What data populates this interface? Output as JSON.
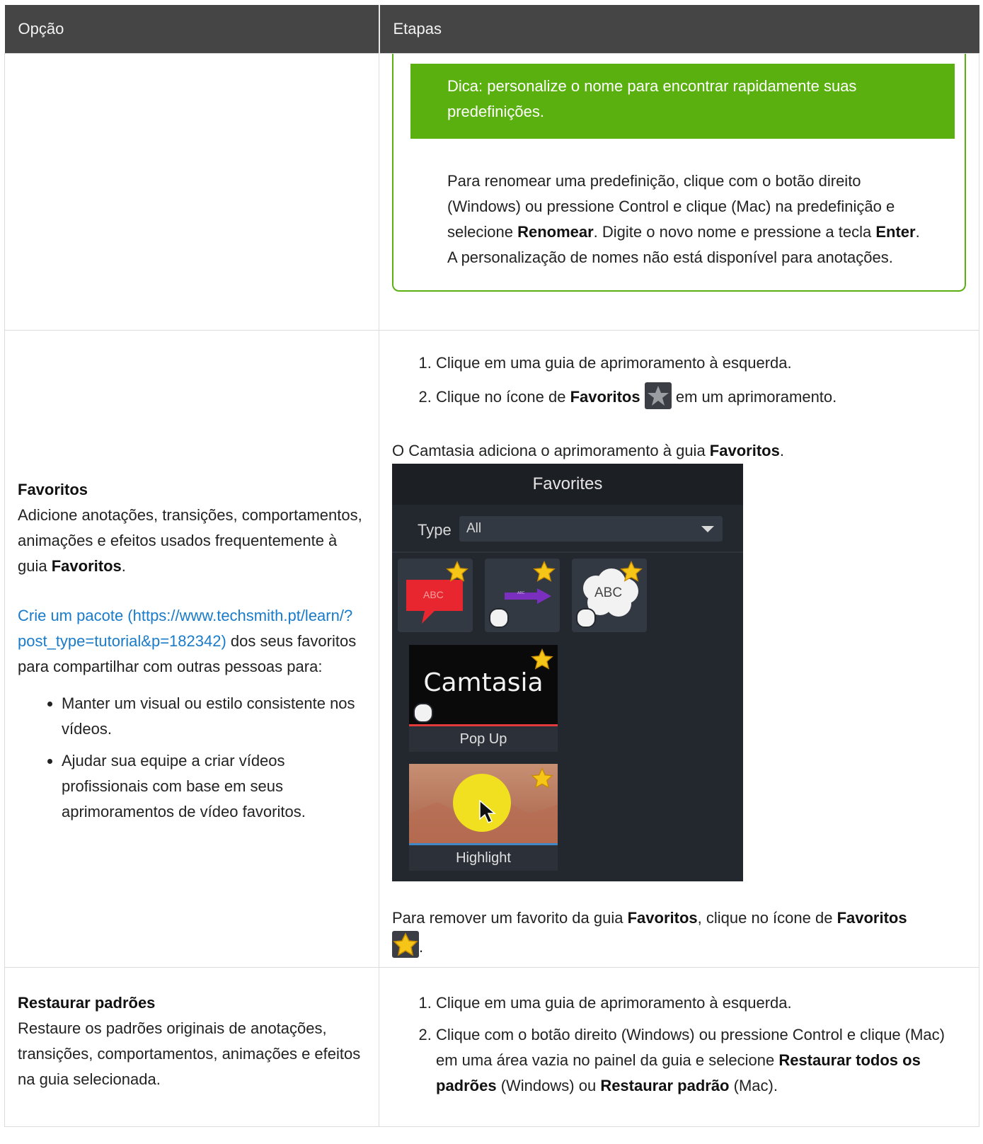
{
  "table": {
    "header": {
      "col1": "Opção",
      "col2": "Etapas"
    },
    "row1": {
      "tip": "Dica: personalize o nome para encontrar rapidamente suas predefinições.",
      "p1": "Para renomear uma predefinição, clique com o botão direito (Windows) ou pressione Control e clique (Mac) na predefinição e selecione ",
      "p1_b1": "Renomear",
      "p1_mid": ". Digite o novo nome e pressione a tecla ",
      "p1_b2": "Enter",
      "p1_end": ". A personalização de nomes não está disponível para anotações."
    },
    "row2": {
      "title": "Favoritos",
      "desc_a": "Adicione anotações, transições, comportamentos, animações e efeitos usados frequentemente à guia ",
      "desc_b": "Favoritos",
      "desc_c": ".",
      "link": "Crie um pacote (https://www.techsmith.pt/learn/?post_type=tutorial&p=182342)",
      "link_after": " dos seus favoritos para compartilhar com outras pessoas para:",
      "bullets": [
        "Manter um visual ou estilo consistente nos vídeos.",
        "Ajudar sua equipe a criar vídeos profissionais com base em seus aprimoramentos de vídeo favoritos."
      ],
      "step1": "Clique em uma guia de aprimoramento à esquerda.",
      "step2_a": "Clique no ícone de ",
      "step2_b": "Favoritos",
      "step2_c": " em um aprimoramento.",
      "result_a": "O Camtasia adiciona o aprimoramento à guia ",
      "result_b": "Favoritos",
      "result_c": ".",
      "panel": {
        "title": "Favorites",
        "type_label": "Type",
        "type_value": "All",
        "tile1_text": "ABC",
        "tile2_text": "ABC",
        "tile3_text": "ABC",
        "camtasia_text": "Camtasia",
        "popup_label": "Pop Up",
        "highlight_label": "Highlight"
      },
      "remove_a": "Para remover um favorito da guia ",
      "remove_b": "Favoritos",
      "remove_c": ", clique no ícone de ",
      "remove_d": "Favoritos",
      "remove_e": "."
    },
    "row3": {
      "title": "Restaurar padrões",
      "desc": "Restaure os padrões originais de anotações, transições, comportamentos, animações e efeitos na guia selecionada.",
      "step1": "Clique em uma guia de aprimoramento à esquerda.",
      "step2_a": "Clique com o botão direito (Windows) ou pressione Control e clique (Mac) em uma área vazia no painel da guia e selecione ",
      "step2_b": "Restaurar todos os padrões",
      "step2_c": " (Windows) ou ",
      "step2_d": "Restaurar padrão",
      "step2_e": " (Mac)."
    }
  }
}
